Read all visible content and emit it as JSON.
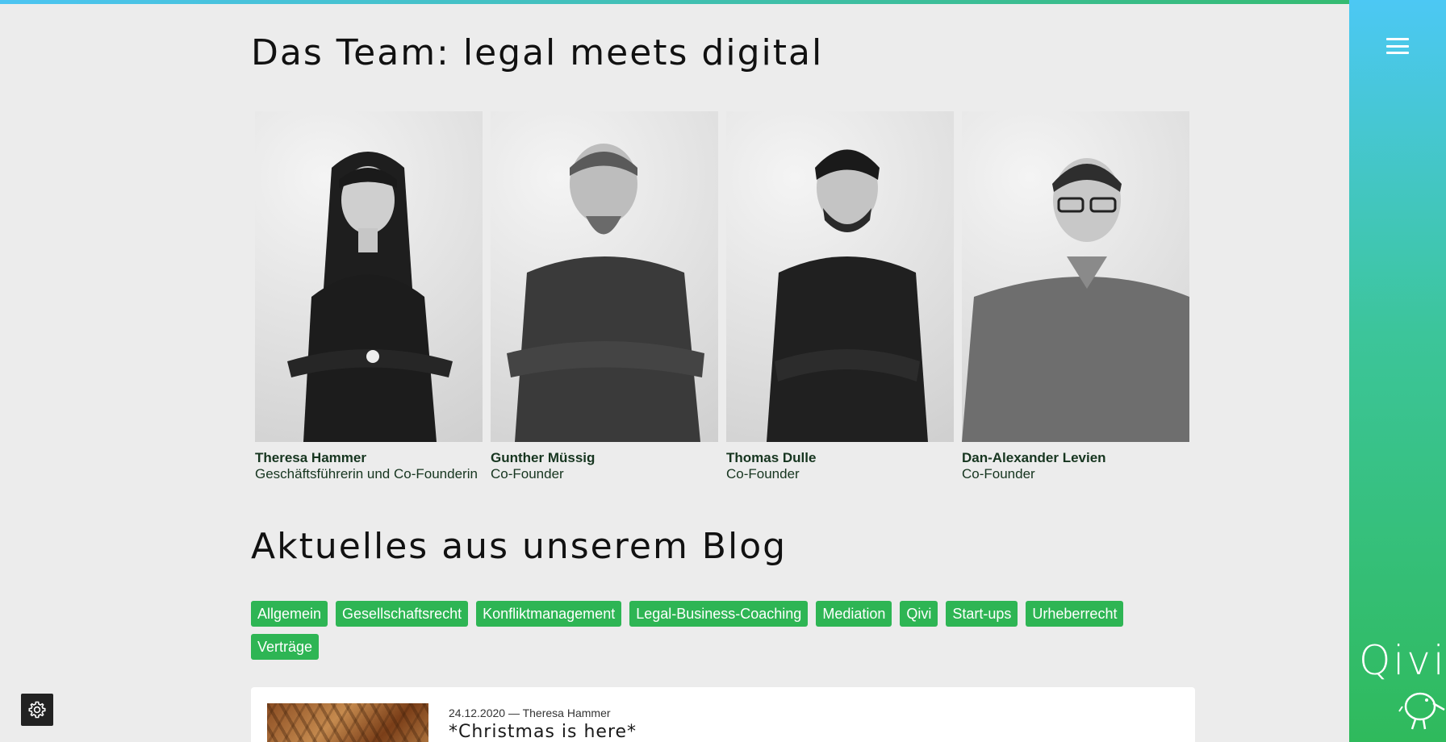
{
  "colors": {
    "accent": "#2eb554",
    "sidebar_top": "#4cc8f4",
    "sidebar_bottom": "#2fba5c",
    "background": "#ececec"
  },
  "sidebar": {
    "menu_icon": "hamburger-icon",
    "brand_name": "Qivi",
    "brand_icon": "kiwi-bird-icon"
  },
  "team": {
    "title": "Das Team: legal meets digital",
    "members": [
      {
        "name": "Theresa Hammer",
        "role": "Geschäftsführerin und Co-Founderin"
      },
      {
        "name": "Gunther Müssig",
        "role": "Co-Founder"
      },
      {
        "name": "Thomas Dulle",
        "role": "Co-Founder"
      },
      {
        "name": "Dan-Alexander Levien",
        "role": "Co-Founder"
      }
    ]
  },
  "blog": {
    "title": "Aktuelles aus unserem Blog",
    "categories": [
      "Allgemein",
      "Gesellschaftsrecht",
      "Konfliktmanagement",
      "Legal-Business-Coaching",
      "Mediation",
      "Qivi",
      "Start-ups",
      "Urheberrecht",
      "Verträge"
    ],
    "posts": [
      {
        "meta": "24.12.2020 — Theresa Hammer",
        "title": "*Christmas is here*"
      }
    ]
  },
  "settings": {
    "icon": "gear-icon"
  }
}
